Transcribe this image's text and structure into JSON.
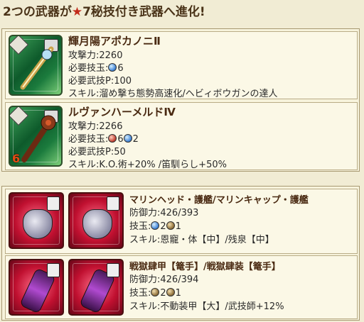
{
  "header": {
    "title_prefix": "2つの武器が",
    "title_star": "★",
    "title_suffix": "7秘技付き武器へ進化!"
  },
  "weapons": [
    {
      "name": "輝月陽アポカノニⅡ",
      "atk": "攻撃力:2260",
      "slots_label": "必要技玉:",
      "slots": [
        {
          "color": "b",
          "count": "6"
        }
      ],
      "req": "必要武技P:100",
      "skill": "スキル:溜め撃ち態勢高速化/ヘビィボウガンの達人",
      "icon_number": ""
    },
    {
      "name": "ルヴァンハーメルドⅣ",
      "atk": "攻撃力:2266",
      "slots_label": "必要技玉:",
      "slots": [
        {
          "color": "r",
          "count": "6"
        },
        {
          "color": "b",
          "count": "2"
        }
      ],
      "req": "必要武技P:50",
      "skill": "スキル:K.O.術+20% /笛馴らし+50%",
      "icon_number": "6"
    }
  ],
  "armors": [
    {
      "name": "マリンヘッド・護艦/マリンキャップ・護艦",
      "def": "防御力:426/393",
      "slots_label": "技玉:",
      "slots": [
        {
          "color": "b",
          "count": "2"
        },
        {
          "color": "g",
          "count": "1"
        }
      ],
      "skill": "スキル:恩寵・体【中】/残泉【中】"
    },
    {
      "name": "戦獄肆甲【篭手】/戦獄肆装【篭手】",
      "def": "防御力:426/394",
      "slots_label": "技玉:",
      "slots": [
        {
          "color": "g",
          "count": "2"
        },
        {
          "color": "g",
          "count": "1"
        }
      ],
      "skill": "スキル:不動装甲【大】/武技師+12%"
    }
  ]
}
